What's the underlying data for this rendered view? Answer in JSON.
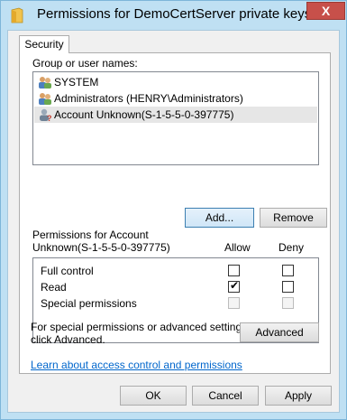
{
  "window": {
    "title": "Permissions for DemoCertServer private keys",
    "close_glyph": "X"
  },
  "tabs": [
    {
      "label": "Security"
    }
  ],
  "group_section": {
    "label": "Group or user names:",
    "items": [
      {
        "label": "SYSTEM",
        "icon": "users-group-icon",
        "selected": false
      },
      {
        "label": "Administrators (HENRY\\Administrators)",
        "icon": "users-group-icon",
        "selected": false
      },
      {
        "label": "Account Unknown(S-1-5-5-0-397775)",
        "icon": "unknown-user-icon",
        "selected": true
      }
    ]
  },
  "buttons": {
    "add_label": "Add...",
    "remove_label": "Remove",
    "advanced_label": "Advanced",
    "ok_label": "OK",
    "cancel_label": "Cancel",
    "apply_label": "Apply"
  },
  "permissions": {
    "label_line1": "Permissions for Account",
    "label_line2": "Unknown(S-1-5-5-0-397775)",
    "allow_header": "Allow",
    "deny_header": "Deny",
    "rows": [
      {
        "name": "Full control",
        "allow": false,
        "deny": false,
        "enabled": true
      },
      {
        "name": "Read",
        "allow": true,
        "deny": false,
        "enabled": true
      },
      {
        "name": "Special permissions",
        "allow": false,
        "deny": false,
        "enabled": false
      }
    ]
  },
  "advanced_note": {
    "line1": "For special permissions or advanced settings,",
    "line2": "click Advanced."
  },
  "learn_link": "Learn about access control and permissions",
  "colors": {
    "titlebar": "#bfe0f3",
    "close_button": "#c7504a",
    "link": "#0066cc"
  }
}
